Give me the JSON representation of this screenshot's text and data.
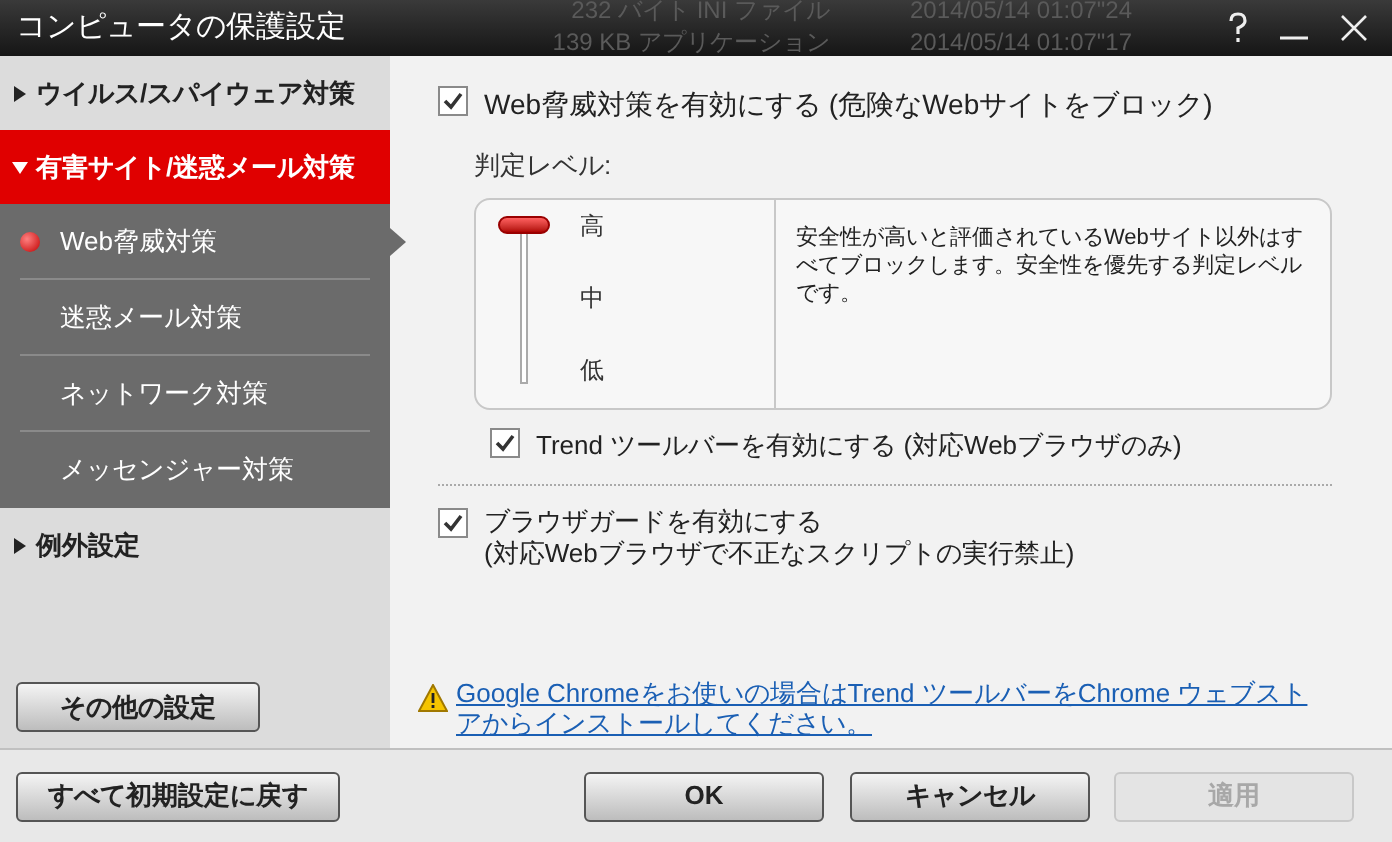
{
  "window": {
    "title": "コンピュータの保護設定",
    "background_rows": [
      [
        "232 バイト INI ファイル",
        "2014/05/14 01:07\"24"
      ],
      [
        "139 KB アプリケーション",
        "2014/05/14 01:07\"17"
      ]
    ]
  },
  "sidebar": {
    "sections": [
      {
        "label": "ウイルス/スパイウェア対策",
        "expanded": false
      },
      {
        "label": "有害サイト/迷惑メール対策",
        "expanded": true,
        "children": [
          {
            "label": "Web脅威対策",
            "selected": true
          },
          {
            "label": "迷惑メール対策",
            "selected": false
          },
          {
            "label": "ネットワーク対策",
            "selected": false
          },
          {
            "label": "メッセンジャー対策",
            "selected": false
          }
        ]
      },
      {
        "label": "例外設定",
        "expanded": false
      }
    ],
    "other_button": "その他の設定"
  },
  "main": {
    "web_threat": {
      "label": "Web脅威対策を有効にする (危険なWebサイトをブロック)",
      "checked": true
    },
    "level_label": "判定レベル:",
    "level_slider": {
      "level": 1,
      "ticks": [
        "高",
        "中",
        "低"
      ]
    },
    "level_description": "安全性が高いと評価されているWebサイト以外はすべてブロックします。安全性を優先する判定レベルです。",
    "toolbar": {
      "label": "Trend ツールバーを有効にする (対応Webブラウザのみ)",
      "checked": true
    },
    "browser_guard": {
      "label": "ブラウザガードを有効にする",
      "note": "(対応Webブラウザで不正なスクリプトの実行禁止)",
      "checked": true
    },
    "chrome_link": "Google Chromeをお使いの場合はTrend ツールバーをChrome ウェブストアからインストールしてください。"
  },
  "footer": {
    "reset": "すべて初期設定に戻す",
    "ok": "OK",
    "cancel": "キャンセル",
    "apply": {
      "label": "適用",
      "disabled": true
    }
  }
}
